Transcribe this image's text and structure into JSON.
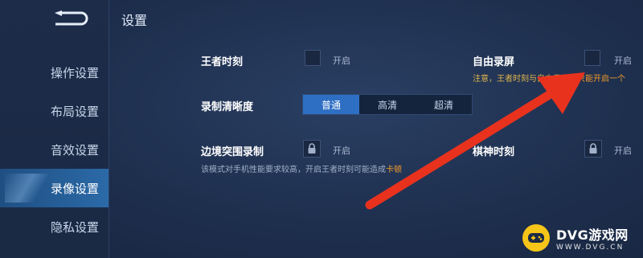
{
  "header": {
    "title": "设置",
    "back_icon": "back-arrow-icon"
  },
  "sidebar": {
    "items": [
      {
        "label": "操作设置",
        "active": false
      },
      {
        "label": "布局设置",
        "active": false
      },
      {
        "label": "音效设置",
        "active": false
      },
      {
        "label": "录像设置",
        "active": true
      },
      {
        "label": "隐私设置",
        "active": false
      }
    ]
  },
  "settings": {
    "king_moment": {
      "label": "王者时刻",
      "state": "开启"
    },
    "free_record": {
      "label": "自由录屏",
      "state": "开启",
      "note_prefix": "注意，王者时刻与自由录屏，",
      "note_highlight": "只能开启一个"
    },
    "clarity": {
      "label": "录制清晰度",
      "options": [
        "普通",
        "高清",
        "超清"
      ],
      "selected": "普通"
    },
    "border_record": {
      "label": "边境突围录制",
      "state": "开启",
      "locked": true,
      "note_prefix": "该模式对手机性能要求较高，开启王者时刻可能造成",
      "note_highlight": "卡顿"
    },
    "chess_moment": {
      "label": "棋神时刻",
      "state": "开启",
      "locked": true
    }
  },
  "watermark": {
    "main": "DVG游戏网",
    "sub": "WWW.DVG.CN"
  },
  "colors": {
    "accent": "#2e6fc4",
    "note_yellow": "#e0b64a",
    "note_orange": "#f09a2a",
    "arrow": "#e8321e"
  }
}
